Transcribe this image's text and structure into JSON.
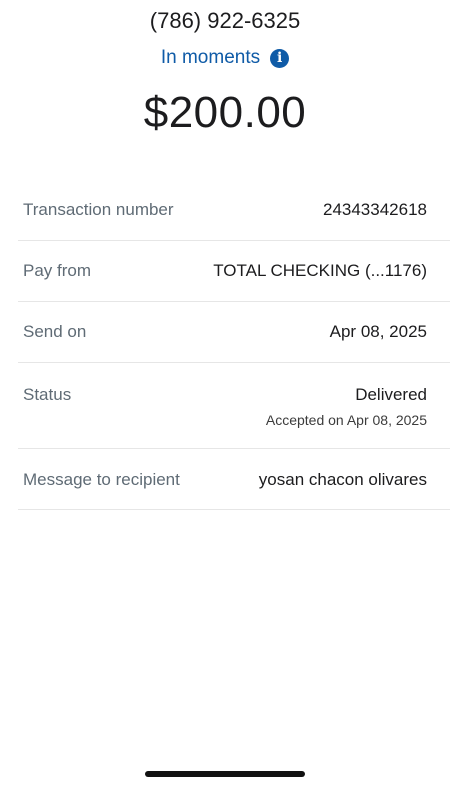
{
  "recipient": {
    "phone": "(786) 922-6325"
  },
  "delivery": {
    "timing_label": "In moments",
    "info_icon": "info-icon"
  },
  "amount": "$200.00",
  "details": {
    "transaction_number_label": "Transaction number",
    "transaction_number_value": "24343342618",
    "pay_from_label": "Pay from",
    "pay_from_value": "TOTAL CHECKING (...1176)",
    "send_on_label": "Send on",
    "send_on_value": "Apr 08, 2025",
    "status_label": "Status",
    "status_value": "Delivered",
    "status_detail": "Accepted on Apr 08, 2025",
    "message_label": "Message to recipient",
    "message_value": "yosan chacon olivares"
  },
  "colors": {
    "accent": "#0f5ba7",
    "label": "#5f6b75",
    "divider": "#e6e6e6"
  }
}
